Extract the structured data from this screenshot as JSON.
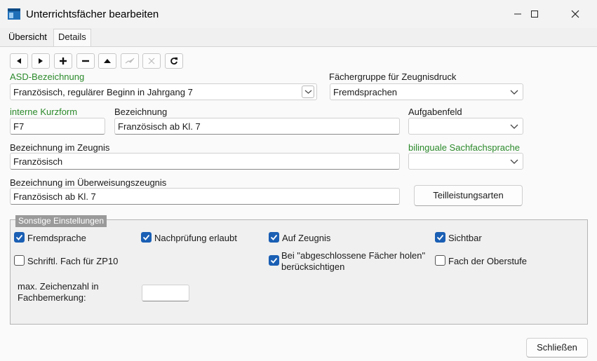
{
  "window": {
    "title": "Unterrichtsfächer bearbeiten"
  },
  "tabs": [
    {
      "label": "Übersicht"
    },
    {
      "label": "Details"
    }
  ],
  "toolbar": {
    "buttons": [
      {
        "icon": "arrow-left-icon",
        "enabled": true
      },
      {
        "icon": "arrow-right-icon",
        "enabled": true
      },
      {
        "icon": "plus-icon",
        "enabled": true
      },
      {
        "icon": "minus-icon",
        "enabled": true
      },
      {
        "icon": "arrow-up-icon",
        "enabled": true
      },
      {
        "icon": "check-icon",
        "enabled": false
      },
      {
        "icon": "cancel-icon",
        "enabled": false
      },
      {
        "icon": "refresh-icon",
        "enabled": true
      }
    ]
  },
  "form": {
    "asd": {
      "label": "ASD-Bezeichnung",
      "value": "Französisch, regulärer Beginn in Jahrgang 7"
    },
    "faechergruppe": {
      "label": "Fächergruppe für Zeugnisdruck",
      "value": "Fremdsprachen"
    },
    "kurzform": {
      "label": "interne Kurzform",
      "value": "F7"
    },
    "bezeichnung": {
      "label": "Bezeichnung",
      "value": "Französisch ab Kl. 7"
    },
    "aufgabenfeld": {
      "label": "Aufgabenfeld",
      "value": ""
    },
    "zeugnis": {
      "label": "Bezeichnung im Zeugnis",
      "value": "Französisch"
    },
    "bilingual": {
      "label": "bilinguale Sachfachsprache",
      "value": ""
    },
    "ueberweisung": {
      "label": "Bezeichnung im Überweisungszeugnis",
      "value": "Französisch ab Kl. 7"
    },
    "teilleistung_button": "Teilleistungsarten"
  },
  "settings": {
    "title": "Sonstige Einstellungen",
    "checkboxes": {
      "fremdsprache": {
        "label": "Fremdsprache",
        "checked": true
      },
      "nachpruefung": {
        "label": "Nachprüfung erlaubt",
        "checked": true
      },
      "aufzeugnis": {
        "label": "Auf Zeugnis",
        "checked": true
      },
      "sichtbar": {
        "label": "Sichtbar",
        "checked": true
      },
      "schriftl": {
        "label": "Schriftl. Fach für ZP10",
        "checked": false
      },
      "abgeschlossen": {
        "label_line1": "Bei \"abgeschlossene Fächer holen\"",
        "label_line2": "berücksichtigen",
        "checked": true
      },
      "oberstufe": {
        "label": "Fach der Oberstufe",
        "checked": false
      }
    },
    "maxzeichen": {
      "label_line1": "max. Zeichenzahl in",
      "label_line2": "Fachbemerkung:",
      "value": ""
    }
  },
  "footer": {
    "close_label": "Schließen"
  },
  "colors": {
    "accent": "#1a5fb4",
    "green_label": "#2b8a2b"
  }
}
